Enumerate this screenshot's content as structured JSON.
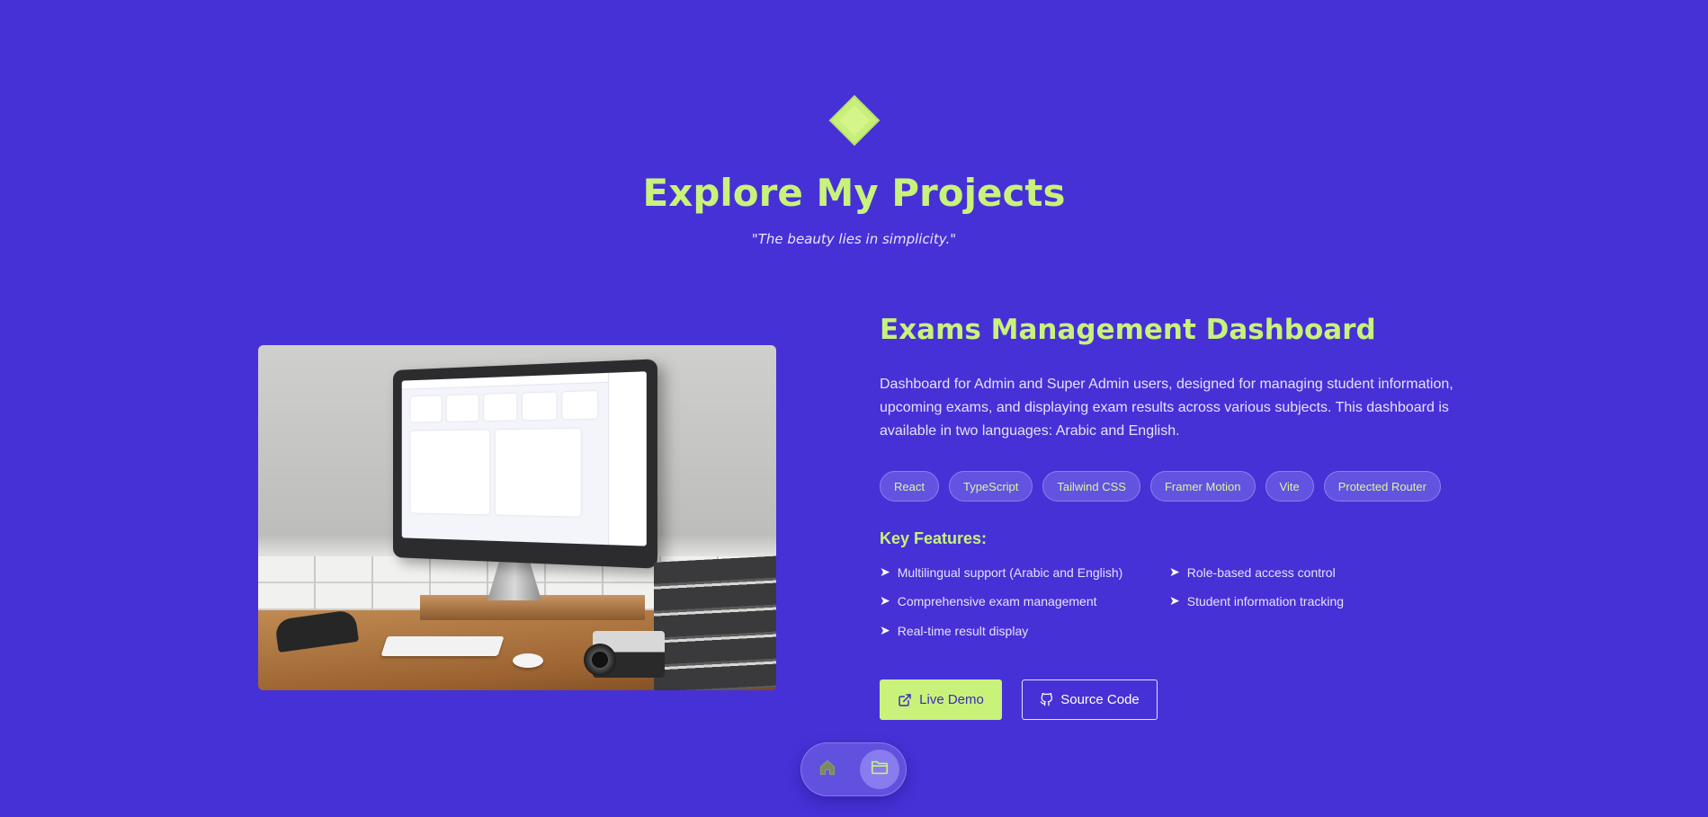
{
  "header": {
    "title": "Explore My Projects",
    "tagline": "\"The beauty lies in simplicity.\""
  },
  "project": {
    "title": "Exams Management Dashboard",
    "description": "Dashboard for Admin and Super Admin users, designed for managing student information, upcoming exams, and displaying exam results across various subjects. This dashboard is available in two languages: Arabic and English.",
    "tags": [
      "React",
      "TypeScript",
      "Tailwind CSS",
      "Framer Motion",
      "Vite",
      "Protected Router"
    ],
    "features_heading": "Key Features:",
    "features": [
      "Multilingual support (Arabic and English)",
      "Role-based access control",
      "Comprehensive exam management",
      "Student information tracking",
      "Real-time result display"
    ],
    "live_demo_label": "Live Demo",
    "source_code_label": "Source Code"
  },
  "nav": {
    "items": [
      {
        "icon": "home-icon",
        "active": false
      },
      {
        "icon": "folder-icon",
        "active": true
      }
    ]
  },
  "colors": {
    "background": "#4631d6",
    "accent": "#c9f27a",
    "text": "#e5e2ff"
  }
}
